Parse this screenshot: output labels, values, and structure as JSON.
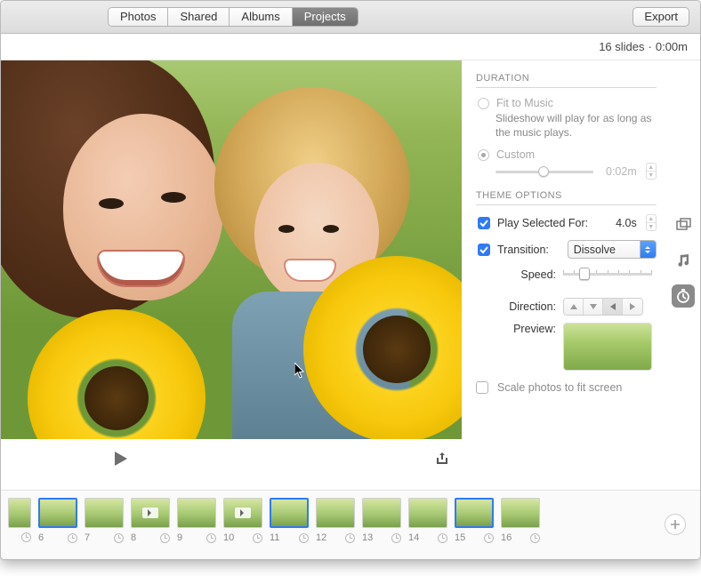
{
  "toolbar": {
    "tabs": [
      "Photos",
      "Shared",
      "Albums",
      "Projects"
    ],
    "active_tab_index": 3,
    "export_label": "Export"
  },
  "status": {
    "slides_text": "16 slides",
    "time_text": "0:00m"
  },
  "duration": {
    "section_label": "DURATION",
    "fit_label": "Fit to Music",
    "fit_help": "Slideshow will play for as long as the music plays.",
    "custom_label": "Custom",
    "custom_value": "0:02m",
    "custom_selected": true
  },
  "theme": {
    "section_label": "THEME OPTIONS",
    "play_selected_label": "Play Selected For:",
    "play_selected_value": "4.0s",
    "play_selected_checked": true,
    "transition_label": "Transition:",
    "transition_value": "Dissolve",
    "transition_checked": true,
    "speed_label": "Speed:",
    "direction_label": "Direction:",
    "preview_label": "Preview:",
    "scale_checked": false,
    "scale_label": "Scale photos to fit screen"
  },
  "rail": {
    "icons": [
      "overlay-icon",
      "music-icon",
      "timer-icon"
    ],
    "active_index": 2
  },
  "filmstrip": {
    "items": [
      {
        "n": 6,
        "selected": true,
        "video": false
      },
      {
        "n": 7,
        "selected": false,
        "video": false
      },
      {
        "n": 8,
        "selected": false,
        "video": true
      },
      {
        "n": 9,
        "selected": false,
        "video": false
      },
      {
        "n": 10,
        "selected": false,
        "video": true
      },
      {
        "n": 11,
        "selected": true,
        "video": false
      },
      {
        "n": 12,
        "selected": false,
        "video": false
      },
      {
        "n": 13,
        "selected": false,
        "video": false
      },
      {
        "n": 14,
        "selected": false,
        "video": false
      },
      {
        "n": 15,
        "selected": true,
        "video": false
      },
      {
        "n": 16,
        "selected": false,
        "video": false
      }
    ]
  }
}
